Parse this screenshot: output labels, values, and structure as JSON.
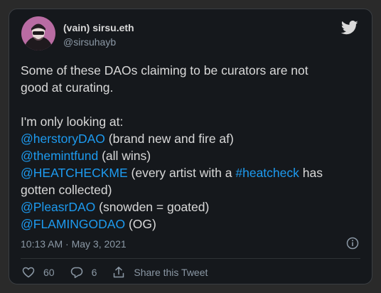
{
  "author": {
    "display_name": "(vain) sirsu.eth",
    "handle": "@sirsuhayb",
    "avatar_icon": "avatar-person-icon"
  },
  "tweet": {
    "line1": "Some of these DAOs claiming to be curators are not",
    "line2": "good at curating.",
    "line3": "I'm only looking at:",
    "mentions": [
      {
        "handle": "@herstoryDAO",
        "note": " (brand new and fire af)"
      },
      {
        "handle": "@themintfund",
        "note": " (all wins)"
      },
      {
        "handle": "@HEATCHECKME",
        "note": " (every artist with a "
      },
      {
        "handle": "@PleasrDAO",
        "note": " (snowden = goated)"
      },
      {
        "handle": "@FLAMINGODAO",
        "note": " (OG)"
      }
    ],
    "hashtag": "#heatcheck",
    "hashtag_after": " has",
    "continuation": "gotten collected)",
    "timestamp": "10:13 AM · May 3, 2021"
  },
  "actions": {
    "likes": "60",
    "replies": "6",
    "share_label": "Share this Tweet"
  },
  "colors": {
    "background": "#15181c",
    "text": "#d9d9d9",
    "link": "#1d9bf0",
    "muted": "#8b98a5"
  }
}
